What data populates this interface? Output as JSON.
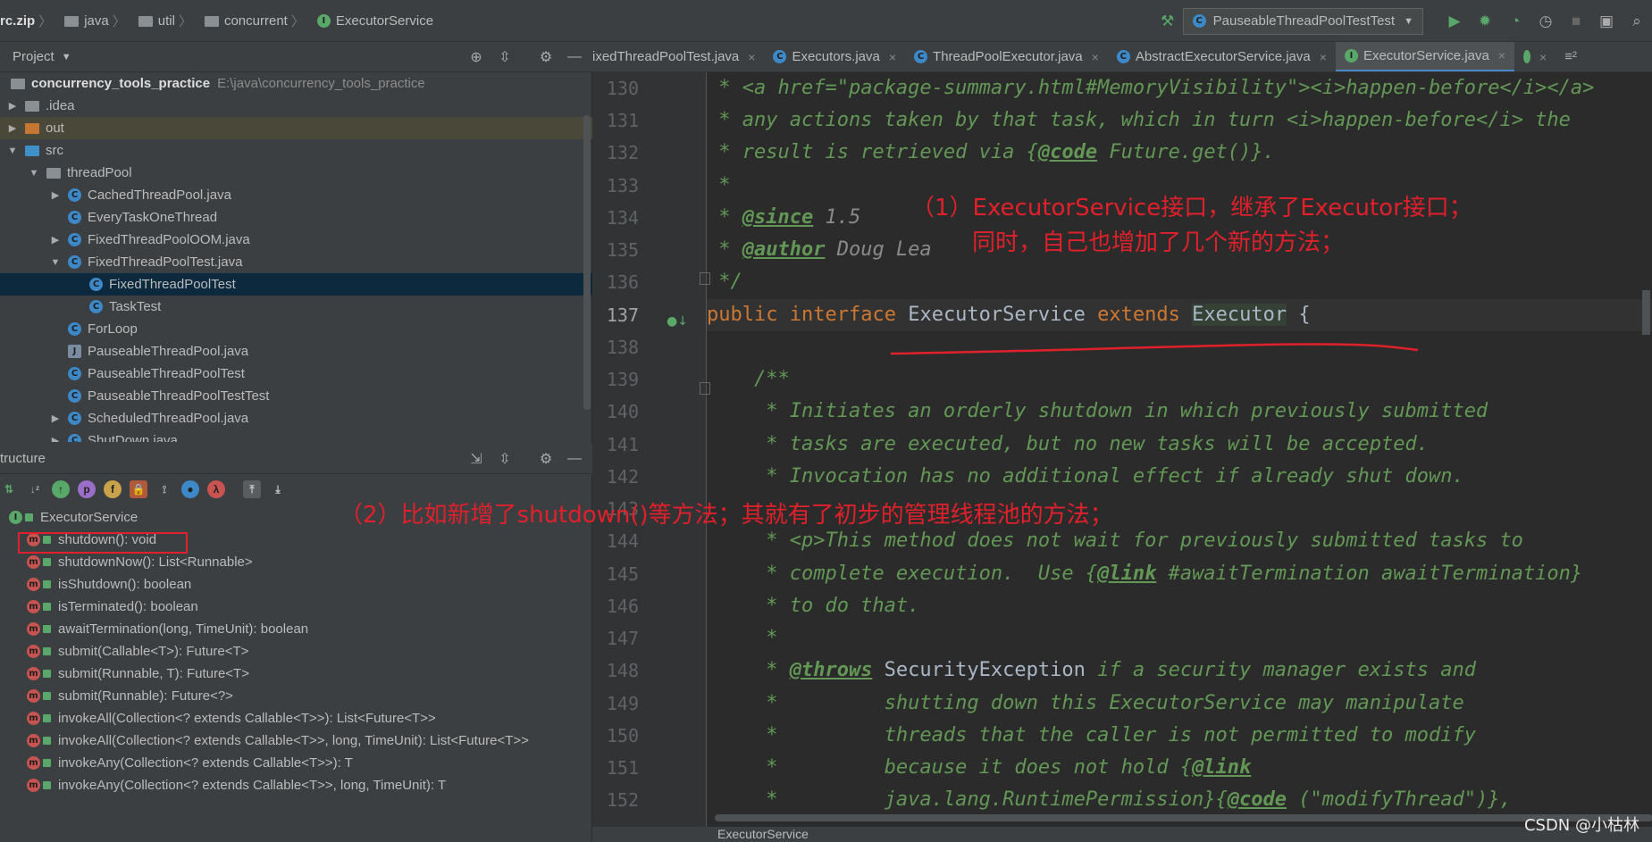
{
  "breadcrumbs": [
    "rc.zip",
    "java",
    "util",
    "concurrent",
    "ExecutorService"
  ],
  "run_config": "PauseableThreadPoolTestTest",
  "project_panel": {
    "title": "Project",
    "project_name": "concurrency_tools_practice",
    "project_path": "E:\\java\\concurrency_tools_practice",
    "items": [
      ".idea",
      "out",
      "src",
      "threadPool",
      "CachedThreadPool.java",
      "EveryTaskOneThread",
      "FixedThreadPoolOOM.java",
      "FixedThreadPoolTest.java",
      "FixedThreadPoolTest",
      "TaskTest",
      "ForLoop",
      "PauseableThreadPool.java",
      "PauseableThreadPoolTest",
      "PauseableThreadPoolTestTest",
      "ScheduledThreadPool.java",
      "ShutDown.java"
    ]
  },
  "structure_panel": {
    "title": "tructure",
    "root": "ExecutorService",
    "methods": [
      "shutdown(): void",
      "shutdownNow(): List<Runnable>",
      "isShutdown(): boolean",
      "isTerminated(): boolean",
      "awaitTermination(long, TimeUnit): boolean",
      "submit(Callable<T>): Future<T>",
      "submit(Runnable, T): Future<T>",
      "submit(Runnable): Future<?>",
      "invokeAll(Collection<? extends Callable<T>>): List<Future<T>>",
      "invokeAll(Collection<? extends Callable<T>>, long, TimeUnit): List<Future<T>>",
      "invokeAny(Collection<? extends Callable<T>>): T",
      "invokeAny(Collection<? extends Callable<T>>, long, TimeUnit): T"
    ]
  },
  "editor_tabs": [
    {
      "label": "ixedThreadPoolTest.java",
      "active": false
    },
    {
      "label": "Executors.java",
      "active": false
    },
    {
      "label": "ThreadPoolExecutor.java",
      "active": false
    },
    {
      "label": "AbstractExecutorService.java",
      "active": false
    },
    {
      "label": "ExecutorService.java",
      "active": true
    }
  ],
  "line_numbers": [
    "130",
    "131",
    "132",
    "133",
    "134",
    "135",
    "136",
    "137",
    "138",
    "139",
    "140",
    "141",
    "142",
    "143",
    "144",
    "145",
    "146",
    "147",
    "148",
    "149",
    "150",
    "151",
    "152"
  ],
  "code": {
    "l130a": " * ",
    "l130b": "<a href=\"package-summary.html#MemoryVisibility\"><i>happen-before</i></a>",
    "l131a": " * any actions taken by that task, which in turn ",
    "l131b": "<i>",
    "l131c": "happen-before",
    "l131d": "</i>",
    "l131e": " the",
    "l132a": " * result is retrieved via {",
    "l132b": "@code",
    "l132c": " Future.get()}.",
    "l133": " *",
    "l134a": " * ",
    "l134b": "@since",
    "l134c": " 1.5",
    "l135a": " * ",
    "l135b": "@author",
    "l135c": " Doug Lea",
    "l136": " */",
    "l137a": "public",
    "l137b": "interface",
    "l137c": "ExecutorService",
    "l137d": "extends",
    "l137e": "Executor",
    "l137f": "{",
    "l139": "    /**",
    "l140": "     * Initiates an orderly shutdown in which previously submitted",
    "l141": "     * tasks are executed, but no new tasks will be accepted.",
    "l142": "     * Invocation has no additional effect if already shut down.",
    "l144a": "     * ",
    "l144b": "<p>",
    "l144c": "This method does not wait for previously submitted tasks to",
    "l145a": "     * complete execution.  Use {",
    "l145b": "@link",
    "l145c": " #awaitTermination awaitTermination}",
    "l146": "     * to do that.",
    "l147": "     *",
    "l148a": "     * ",
    "l148b": "@throws",
    "l148c": " SecurityException",
    "l148d": " if a security manager exists and",
    "l149a": "     *         ",
    "l149b": "shutting down this ExecutorService may manipulate",
    "l150a": "     *         ",
    "l150b": "threads that the caller is not permitted to modify",
    "l151a": "     *         ",
    "l151b": "because it does not hold {",
    "l151c": "@link",
    "l152a": "     *         ",
    "l152b": "java.lang.RuntimePermission}{",
    "l152c": "@code",
    "l152d": " (\"modifyThread\")},"
  },
  "annotations": {
    "a1_line1": "（1）ExecutorService接口，继承了Executor接口；",
    "a1_line2": "同时，自己也增加了几个新的方法；",
    "a2": "（2）比如新增了shutdown()等方法；其就有了初步的管理线程池的方法；"
  },
  "status_breadcrumb": "ExecutorService",
  "watermark": "CSDN @小枯林"
}
